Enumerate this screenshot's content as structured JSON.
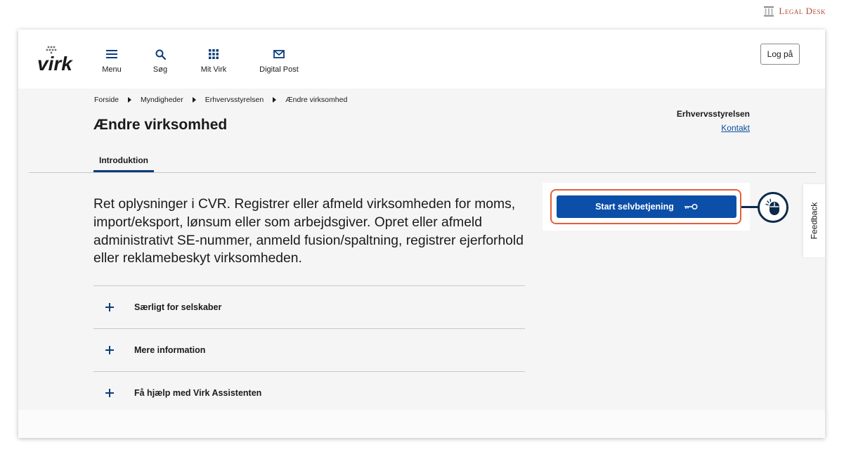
{
  "watermark": {
    "text": "Legal Desk"
  },
  "header": {
    "logo_text": "virk",
    "nav": [
      {
        "label": "Menu",
        "icon": "hamburger-icon"
      },
      {
        "label": "Søg",
        "icon": "search-icon"
      },
      {
        "label": "Mit Virk",
        "icon": "grid-icon"
      },
      {
        "label": "Digital Post",
        "icon": "mail-icon"
      }
    ],
    "login_label": "Log på"
  },
  "breadcrumb": [
    "Forside",
    "Myndigheder",
    "Erhvervsstyrelsen",
    "Ændre virksomhed"
  ],
  "page": {
    "title": "Ændre virksomhed",
    "authority": "Erhvervsstyrelsen",
    "contact_label": "Kontakt",
    "tab_label": "Introduktion",
    "intro": "Ret oplysninger i CVR. Registrer eller afmeld virksomheden for moms, import/eksport, lønsum eller som arbejdsgiver. Opret eller afmeld administrativt SE-nummer, anmeld fusion/spaltning, registrer ejerforhold eller reklamebeskyt virksomheden."
  },
  "accordion": [
    {
      "label": "Særligt for selskaber"
    },
    {
      "label": "Mere information"
    },
    {
      "label": "Få hjælp med Virk Assistenten"
    }
  ],
  "cta": {
    "label": "Start selvbetjening",
    "icon": "key-icon"
  },
  "feedback_label": "Feedback",
  "colors": {
    "primary": "#0b4fa8",
    "highlight": "#e2603d",
    "dark": "#0b2a4a",
    "link": "#0b4fa0"
  }
}
